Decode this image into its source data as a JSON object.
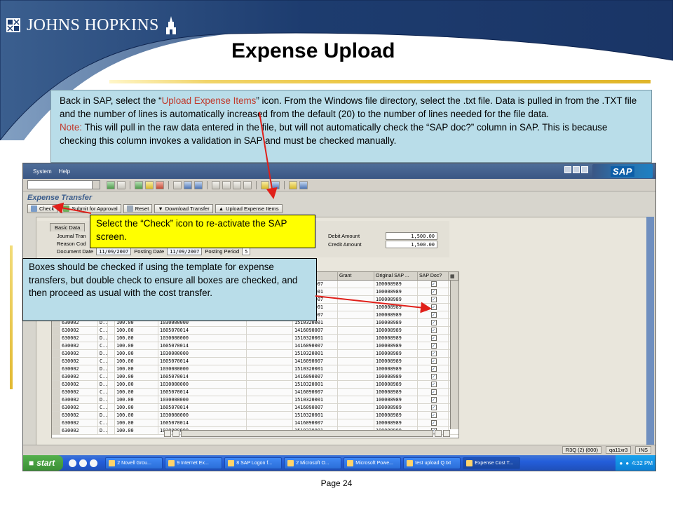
{
  "header": {
    "org": "JOHNS HOPKINS",
    "title": "Expense Upload"
  },
  "intro": {
    "p1_a": "Back in SAP, select the “",
    "p1_hl": "Upload Expense Items",
    "p1_b": "” icon. From the Windows file directory, select the .txt file. Data is pulled in from the .TXT file and the number of lines is automatically increased from the default (20) to the number of lines needed for the file data.",
    "note_label": "Note:",
    "note_text": " This will pull in the raw data entered in the file, but will not automatically check the “SAP doc?” column in SAP. This is because checking this column invokes a validation in SAP and must be checked manually."
  },
  "callouts": {
    "check": "Select the “Check” icon to re-activate the SAP screen.",
    "boxes": "Boxes should be checked if using the template for expense transfers, but double check to ensure all boxes are checked, and then proceed as usual with the cost transfer."
  },
  "sap": {
    "menu": [
      "System",
      "Help"
    ],
    "logo": "SAP",
    "screen_title": "Expense Transfer",
    "buttons": {
      "check": "Check",
      "submit": "Submit for Approval",
      "reset": "Reset",
      "download": "Download Transfer",
      "upload": "Upload Expense Items"
    },
    "header_tab": "Basic Data",
    "fields": {
      "journal_label": "Journal Tran",
      "reason_label": "Reason Cod",
      "doc_date_label": "Document Date",
      "doc_date": "11/09/2007",
      "posting_date_label": "Posting Date",
      "posting_date": "11/09/2007",
      "posting_period_label": "Posting Period",
      "posting_period": "5",
      "debit_label": "Debit Amount",
      "debit": "1,500.00",
      "credit_label": "Credit Amount",
      "credit": "1,500.00"
    },
    "grid_headers": {
      "grant": "Grant",
      "original_sap": "Original SAP ...",
      "sap_doc": "SAP Doc?"
    },
    "grid_rows": [
      {
        "a": "",
        "b": "",
        "amt": "",
        "c1": "",
        "c2": "",
        "d": "1510320007",
        "orig": "100008989"
      },
      {
        "a": "",
        "b": "",
        "amt": "",
        "c1": "",
        "c2": "",
        "d": "1416090001",
        "orig": "100008989"
      },
      {
        "a": "",
        "b": "",
        "amt": "",
        "c1": "",
        "c2": "",
        "d": "1416090007",
        "orig": "100008989"
      },
      {
        "a": "",
        "b": "",
        "amt": "",
        "c1": "",
        "c2": "",
        "d": "1510320001",
        "orig": "100008989"
      },
      {
        "a": "",
        "b": "",
        "amt": "",
        "c1": "",
        "c2": "",
        "d": "1416090007",
        "orig": "100008989"
      },
      {
        "a": "630002",
        "b": "D...",
        "amt": "100.00",
        "c1": "1030000000",
        "c2": "",
        "d": "1510320001",
        "orig": "100008989"
      },
      {
        "a": "630002",
        "b": "C...",
        "amt": "100.00",
        "c1": "1605070014",
        "c2": "",
        "d": "1416090007",
        "orig": "100008989"
      },
      {
        "a": "630002",
        "b": "D...",
        "amt": "100.00",
        "c1": "1030000000",
        "c2": "",
        "d": "1510320001",
        "orig": "100008989"
      },
      {
        "a": "630002",
        "b": "C...",
        "amt": "100.00",
        "c1": "1605070014",
        "c2": "",
        "d": "1416090007",
        "orig": "100008989"
      },
      {
        "a": "630002",
        "b": "D...",
        "amt": "100.00",
        "c1": "1030000000",
        "c2": "",
        "d": "1510320001",
        "orig": "100008989"
      },
      {
        "a": "630002",
        "b": "C...",
        "amt": "100.00",
        "c1": "1605070014",
        "c2": "",
        "d": "1416090007",
        "orig": "100008989"
      },
      {
        "a": "630002",
        "b": "D...",
        "amt": "100.00",
        "c1": "1030000000",
        "c2": "",
        "d": "1510320001",
        "orig": "100008989"
      },
      {
        "a": "630002",
        "b": "C...",
        "amt": "100.00",
        "c1": "1605070014",
        "c2": "",
        "d": "1416090007",
        "orig": "100008989"
      },
      {
        "a": "630002",
        "b": "D...",
        "amt": "100.00",
        "c1": "1030000000",
        "c2": "",
        "d": "1510320001",
        "orig": "100008989"
      },
      {
        "a": "630002",
        "b": "C...",
        "amt": "100.00",
        "c1": "1605070014",
        "c2": "",
        "d": "1416090007",
        "orig": "100008989"
      },
      {
        "a": "630002",
        "b": "D...",
        "amt": "100.00",
        "c1": "1030000000",
        "c2": "",
        "d": "1510320001",
        "orig": "100008989"
      },
      {
        "a": "630002",
        "b": "C...",
        "amt": "100.00",
        "c1": "1605070014",
        "c2": "",
        "d": "1416090007",
        "orig": "100008989"
      },
      {
        "a": "630002",
        "b": "D...",
        "amt": "100.00",
        "c1": "1030000000",
        "c2": "",
        "d": "1510320001",
        "orig": "100008989"
      },
      {
        "a": "630002",
        "b": "C...",
        "amt": "100.00",
        "c1": "1605070014",
        "c2": "",
        "d": "1416090007",
        "orig": "100008989"
      },
      {
        "a": "630002",
        "b": "D...",
        "amt": "100.00",
        "c1": "1030000000",
        "c2": "",
        "d": "1510320001",
        "orig": "100008989"
      }
    ],
    "status": {
      "system": "R3Q (2) (800)",
      "server": "qa11xr3",
      "mode": "INS"
    }
  },
  "taskbar": {
    "start": "start",
    "tasks": [
      "2 Novell Grou...",
      "9 Internet Ex...",
      "8 SAP Logon f...",
      "2 Microsoft O...",
      "Microsoft Powe...",
      "test upload Q.txt",
      "Expense Cost T..."
    ],
    "clock": "4:32 PM"
  },
  "footer": {
    "page": "Page 24"
  },
  "colors": {
    "header_blue": "#1f3f73",
    "note_bg": "#b9dde9",
    "callout_yellow": "#ffff00",
    "arrow_red": "#e0201a",
    "accent_gold": "#e2b931"
  }
}
